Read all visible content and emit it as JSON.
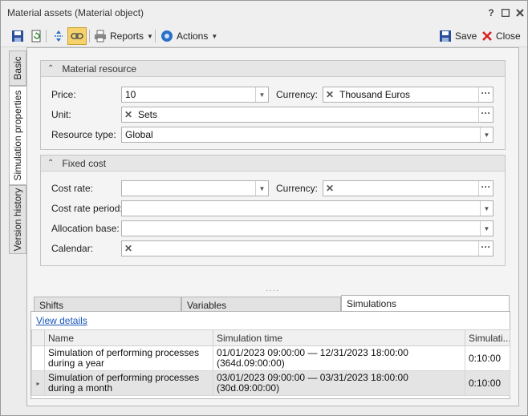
{
  "window": {
    "title": "Material assets (Material object)",
    "help": "?"
  },
  "toolbar": {
    "reports": "Reports",
    "actions": "Actions",
    "save": "Save",
    "close": "Close"
  },
  "side_tabs": [
    "Basic",
    "Simulation properties",
    "Version history"
  ],
  "material_resource": {
    "header": "Material resource",
    "price_label": "Price:",
    "price_value": "10",
    "currency_label": "Currency:",
    "currency_value": "Thousand Euros",
    "unit_label": "Unit:",
    "unit_value": "Sets",
    "resource_type_label": "Resource type:",
    "resource_type_value": "Global"
  },
  "fixed_cost": {
    "header": "Fixed cost",
    "cost_rate_label": "Cost rate:",
    "currency_label": "Currency:",
    "cost_rate_period_label": "Cost rate period:",
    "allocation_base_label": "Allocation base:",
    "calendar_label": "Calendar:"
  },
  "bottom_tabs": [
    "Shifts",
    "Variables",
    "Simulations"
  ],
  "simulations": {
    "view_details": "View details",
    "columns": [
      "Name",
      "Simulation time",
      "Simulati..."
    ],
    "rows": [
      {
        "name": "Simulation of performing processes during a year",
        "time": "01/01/2023 09:00:00 — 12/31/2023 18:00:00 (364d.09:00:00)",
        "duration": "0:10:00"
      },
      {
        "name": "Simulation of performing processes during a month",
        "time": "03/01/2023 09:00:00 — 03/31/2023 18:00:00 (30d.09:00:00)",
        "duration": "0:10:00"
      }
    ]
  },
  "colors": {
    "accent_active": "#f5d36a",
    "link": "#1a54b8",
    "close_red": "#d62020",
    "save_blue": "#2a4f9a"
  }
}
